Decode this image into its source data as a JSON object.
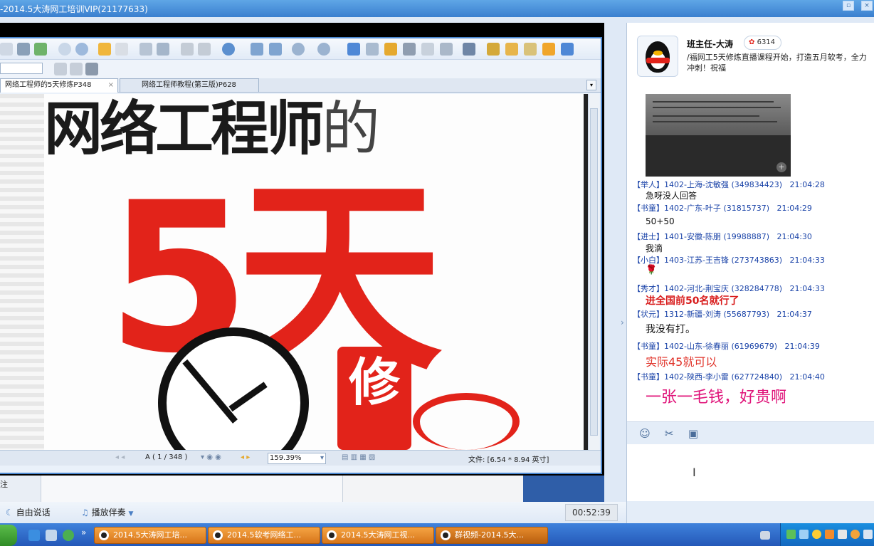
{
  "window": {
    "title": "-2014.5大涛网工培训VIP(21177633)"
  },
  "reader": {
    "tabs": [
      {
        "label": "网络工程师的5天修炼P348",
        "close": "×"
      },
      {
        "label": "网络工程师教程(第三版)P628"
      }
    ],
    "tab_menu": "▾",
    "book": {
      "title_bold": "网络工程师",
      "title_light": "的",
      "big": "5天",
      "seal": "修"
    },
    "status": {
      "page": "A ( 1 / 348 )",
      "zoom": "159.39%",
      "file": "文件: [6.54 * 8.94 英寸]"
    }
  },
  "under_panel": {
    "left_label": "注"
  },
  "controls": {
    "free_talk": "自由说话",
    "play_music": "播放伴奏",
    "timer": "00:52:39"
  },
  "chat": {
    "host": {
      "name": "班主任-大涛",
      "flower_count": "6314"
    },
    "announcement": "/福网工5天修炼直播课程开始，打造五月软考，全力冲刺！祝福",
    "messages": [
      {
        "rank": "【举人】",
        "user": "1402-上海-沈敏强",
        "qq": "(349834423)",
        "time": "21:04:28",
        "text": "急呀没人回答",
        "color": "#111111"
      },
      {
        "rank": "【书童】",
        "user": "1402-广东-叶子",
        "qq": "(31815737)",
        "time": "21:04:29",
        "text": "50+50",
        "color": "#111111"
      },
      {
        "rank": "【进士】",
        "user": "1401-安徽-陈朋",
        "qq": "(19988887)",
        "time": "21:04:30",
        "text": "我滴",
        "color": "#111111"
      },
      {
        "rank": "【小白】",
        "user": "1403-江苏-王吉锋",
        "qq": "(273743863)",
        "time": "21:04:33",
        "text": "🌹",
        "color": "#d81b1b"
      },
      {
        "rank": "【秀才】",
        "user": "1402-河北-荆宝庆",
        "qq": "(328284778)",
        "time": "21:04:33",
        "text": "进全国前50名就行了",
        "color": "#d81b1b"
      },
      {
        "rank": "【状元】",
        "user": "1312-新疆-刘涛",
        "qq": "(55687793)",
        "time": "21:04:37",
        "text": "我没有打。",
        "color": "#111111"
      },
      {
        "rank": "【书童】",
        "user": "1402-山东-徐春丽",
        "qq": "(61969679)",
        "time": "21:04:39",
        "text": "实际45就可以",
        "color": "#e0332a"
      },
      {
        "rank": "【书童】",
        "user": "1402-陕西-李小雷",
        "qq": "(627724840)",
        "time": "21:04:40",
        "text": "一张一毛钱，好贵啊",
        "color": "#e0147a"
      }
    ],
    "tools": {
      "emoji": "☺",
      "scissors": "✂",
      "image": "▣"
    }
  },
  "taskbar": {
    "tasks": [
      {
        "label": "2014.5大涛网工培..."
      },
      {
        "label": "2014.5软考网络工..."
      },
      {
        "label": "2014.5大涛网工视..."
      },
      {
        "label": "群视频-2014.5大..."
      }
    ],
    "quicklaunch_more": "»"
  },
  "colors": {
    "accent": "#3a7fcf",
    "brand_red": "#e2231a",
    "username_blue": "#1a43a8",
    "task_orange": "#d7751a"
  }
}
